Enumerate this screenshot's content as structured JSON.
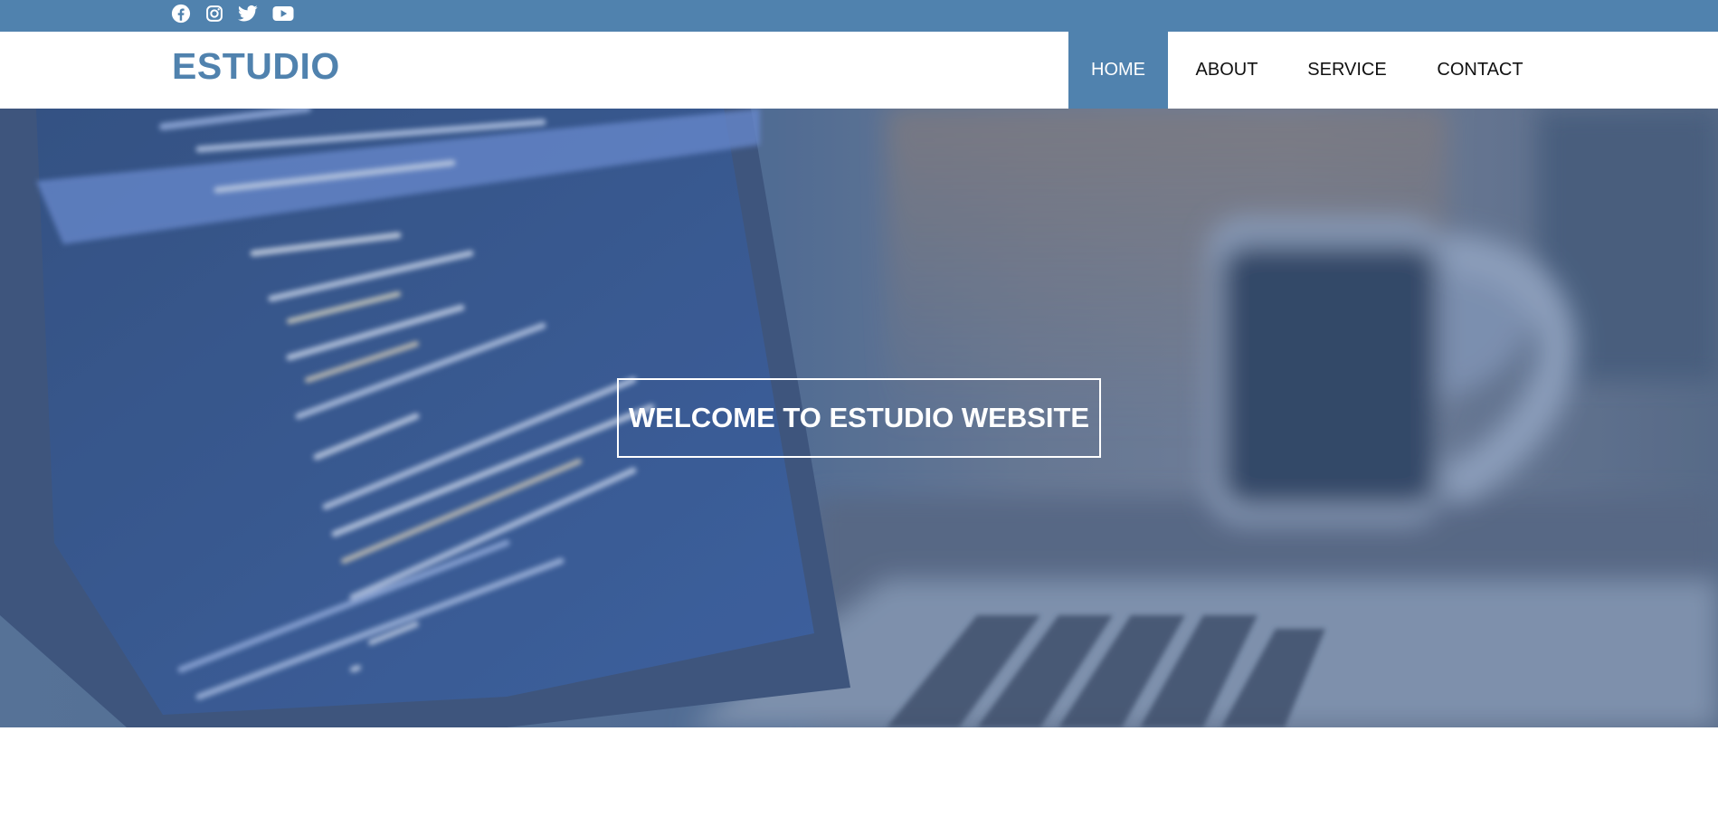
{
  "brand": {
    "logo_text": "ESTUDIO",
    "accent_color": "#5082ae"
  },
  "social": [
    {
      "icon": "facebook-icon"
    },
    {
      "icon": "instagram-icon"
    },
    {
      "icon": "twitter-icon"
    },
    {
      "icon": "youtube-icon"
    }
  ],
  "nav": {
    "items": [
      {
        "label": "HOME",
        "active": true
      },
      {
        "label": "ABOUT",
        "active": false
      },
      {
        "label": "SERVICE",
        "active": false
      },
      {
        "label": "CONTACT",
        "active": false
      }
    ]
  },
  "hero": {
    "title": "WELCOME TO ESTUDIO WEBSITE",
    "background_image": "blurred-laptop-with-code-and-coffee-mug"
  }
}
